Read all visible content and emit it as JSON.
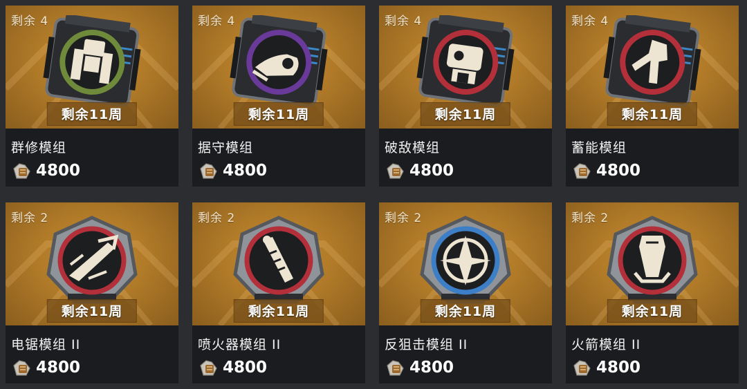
{
  "colors": {
    "card_top": "#b07a28",
    "card_bottom": "#1b1c1f",
    "page_bg": "#2b2d30",
    "ring_green": "#6e8a3a",
    "ring_purple": "#6a3a9a",
    "ring_red": "#b3303a",
    "ring_blue": "#3d7fc6"
  },
  "items": [
    {
      "stock": "剩余 4",
      "weeks": "剩余11周",
      "name": "群修模组",
      "price": "4800",
      "icon": "mech-repair-icon",
      "ring": "green"
    },
    {
      "stock": "剩余 4",
      "weeks": "剩余11周",
      "name": "据守模组",
      "price": "4800",
      "icon": "hold-position-icon",
      "ring": "purple"
    },
    {
      "stock": "剩余 4",
      "weeks": "剩余11周",
      "name": "破敌模组",
      "price": "4800",
      "icon": "breaker-icon",
      "ring": "red"
    },
    {
      "stock": "剩余 4",
      "weeks": "剩余11周",
      "name": "蓄能模组",
      "price": "4800",
      "icon": "charge-icon",
      "ring": "red"
    },
    {
      "stock": "剩余 2",
      "weeks": "剩余11周",
      "name": "电锯模组 II",
      "price": "4800",
      "icon": "chainsaw-icon",
      "ring": "red"
    },
    {
      "stock": "剩余 2",
      "weeks": "剩余11周",
      "name": "喷火器模组 II",
      "price": "4800",
      "icon": "flamethrower-icon",
      "ring": "red"
    },
    {
      "stock": "剩余 2",
      "weeks": "剩余11周",
      "name": "反狙击模组 II",
      "price": "4800",
      "icon": "anti-sniper-icon",
      "ring": "blue"
    },
    {
      "stock": "剩余 2",
      "weeks": "剩余11周",
      "name": "火箭模组 II",
      "price": "4800",
      "icon": "rocket-icon",
      "ring": "red"
    }
  ]
}
